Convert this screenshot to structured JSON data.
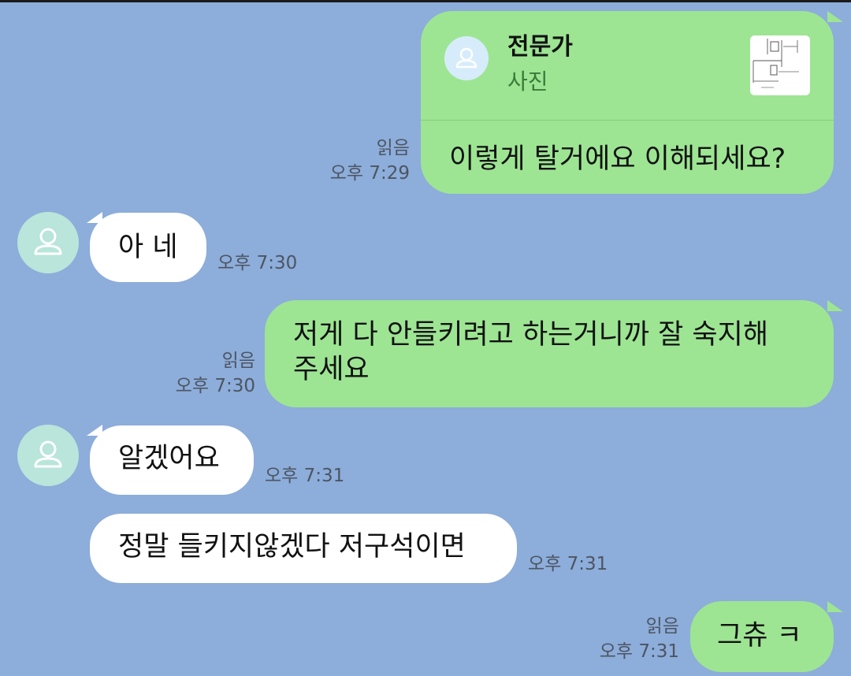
{
  "messages": [
    {
      "id": "m1",
      "side": "me",
      "reply": {
        "name": "전문가",
        "kind": "사진"
      },
      "text": "이렇게 탈거에요 이해되세요?",
      "read": "읽음",
      "time": "오후 7:29"
    },
    {
      "id": "m2",
      "side": "other",
      "text": "아 네",
      "time": "오후 7:30"
    },
    {
      "id": "m3",
      "side": "me",
      "lines": [
        "저게 다 안들키려고 하는거니까 잘 숙지해",
        "주세요"
      ],
      "read": "읽음",
      "time": "오후 7:30"
    },
    {
      "id": "m4",
      "side": "other",
      "text": "알겠어요",
      "time": "오후 7:31"
    },
    {
      "id": "m5",
      "side": "other",
      "text": "정말 들키지않겠다 저구석이면",
      "time": "오후 7:31"
    },
    {
      "id": "m6",
      "side": "me",
      "text": "그츄 ㅋ",
      "read": "읽음",
      "time": "오후 7:31"
    }
  ],
  "colors": {
    "background": "#8DADDA",
    "my_bubble": "#9DE593",
    "other_bubble": "#FFFFFF",
    "avatar": "#B9E5DB",
    "meta_text": "#4C5562"
  },
  "icons": {
    "avatar": "person-icon",
    "thumbnail": "photo-thumbnail"
  }
}
